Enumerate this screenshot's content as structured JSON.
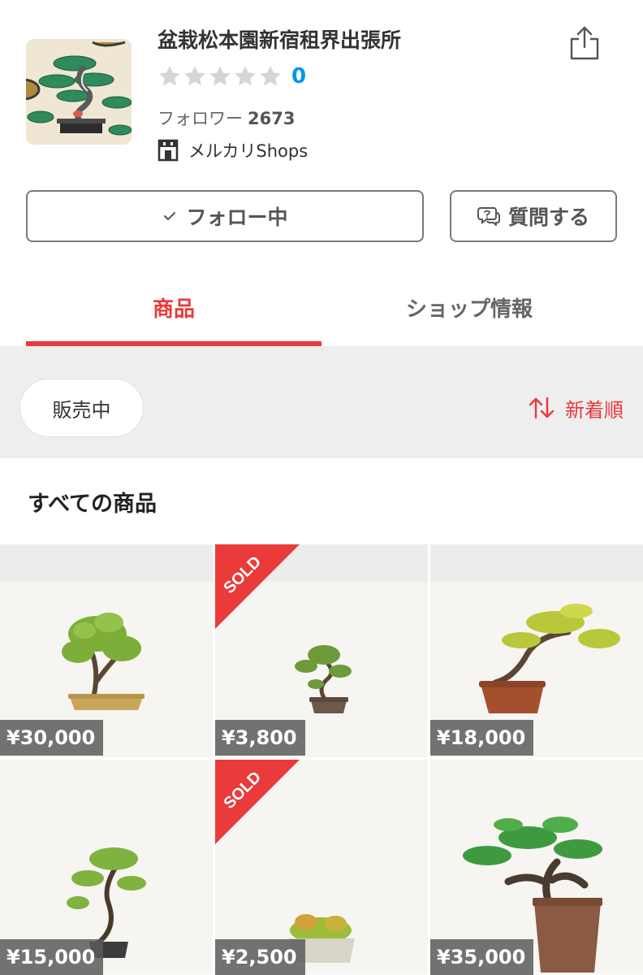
{
  "shop": {
    "name": "盆栽松本園新宿租界出張所",
    "rating_count": "0",
    "followers_label": "フォロワー",
    "followers_count": "2673",
    "shops_label": "メルカリShops"
  },
  "actions": {
    "follow_label": "フォロー中",
    "question_label": "質問する"
  },
  "tabs": [
    {
      "label": "商品",
      "active": true
    },
    {
      "label": "ショップ情報",
      "active": false
    }
  ],
  "filter": {
    "status_label": "販売中",
    "sort_label": "新着順"
  },
  "section_title": "すべての商品",
  "items": [
    {
      "price": "¥30,000",
      "sold": false,
      "sold_text": ""
    },
    {
      "price": "¥3,800",
      "sold": true,
      "sold_text": "SOLD"
    },
    {
      "price": "¥18,000",
      "sold": false,
      "sold_text": ""
    },
    {
      "price": "¥15,000",
      "sold": false,
      "sold_text": ""
    },
    {
      "price": "¥2,500",
      "sold": true,
      "sold_text": "SOLD"
    },
    {
      "price": "¥35,000",
      "sold": false,
      "sold_text": ""
    }
  ],
  "icons": {
    "share": "share-icon",
    "star": "star-icon",
    "store": "store-icon",
    "check": "check-icon",
    "chat": "chat-question-icon",
    "sort": "sort-arrows-icon"
  },
  "colors": {
    "accent": "#ea3a3a",
    "rating_count": "#0095ee",
    "star_empty": "#d5d5d5",
    "filter_bg": "#eeeeee"
  }
}
